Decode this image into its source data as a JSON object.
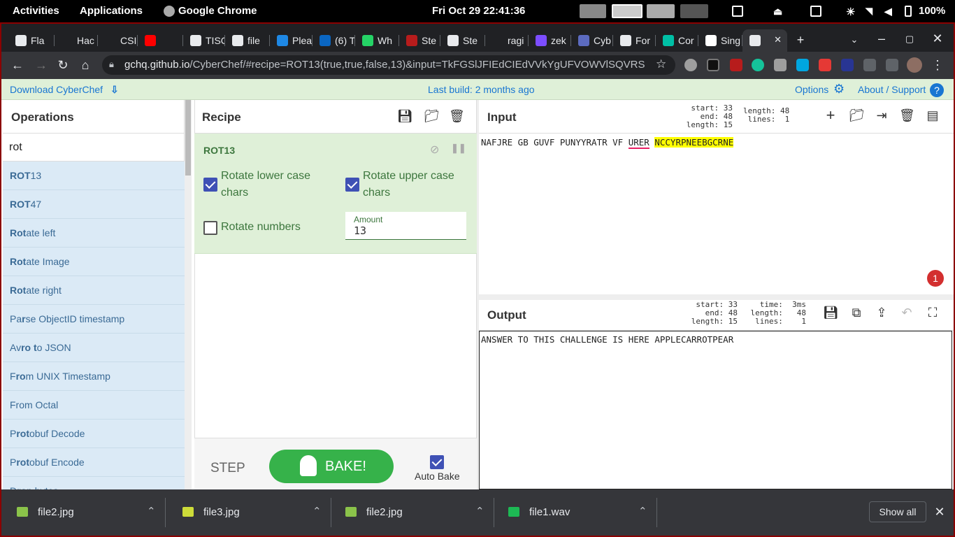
{
  "system": {
    "activities": "Activities",
    "applications": "Applications",
    "app_name": "Google Chrome",
    "clock": "Fri Oct 29  22:41:36",
    "battery": "100%"
  },
  "tabs": [
    {
      "label": "Fla",
      "color": "#e8eaed"
    },
    {
      "label": "Hac",
      "color": "#202124"
    },
    {
      "label": "CSI",
      "color": "#202124"
    },
    {
      "label": "",
      "color": "#ff0000"
    },
    {
      "label": "TISC",
      "color": "#e8eaed"
    },
    {
      "label": "file",
      "color": "#e8eaed"
    },
    {
      "label": "Plea",
      "color": "#1e88e5"
    },
    {
      "label": "(6) T",
      "color": "#0a66c2"
    },
    {
      "label": "Wh",
      "color": "#25d366"
    },
    {
      "label": "Ste",
      "color": "#b71c1c"
    },
    {
      "label": "Ste",
      "color": "#e8eaed"
    },
    {
      "label": "ragi",
      "color": "#202124"
    },
    {
      "label": "zek",
      "color": "#7c4dff"
    },
    {
      "label": "Cyb",
      "color": "#5c6bc0"
    },
    {
      "label": "For",
      "color": "#e8eaed"
    },
    {
      "label": "Cor",
      "color": "#00bfa5"
    },
    {
      "label": "Sing",
      "color": "#ffffff"
    },
    {
      "label": "",
      "color": "#e8eaed"
    }
  ],
  "url": {
    "host": "gchq.github.io",
    "path": "/CyberChef/#recipe=ROT13(true,true,false,13)&input=TkFGSlJFIEdCIEdVVkYgUFVOWVlSQVRSIFZ..."
  },
  "banner": {
    "download": "Download CyberChef",
    "last_build": "Last build: 2 months ago",
    "options": "Options",
    "about": "About / Support"
  },
  "operations": {
    "title": "Operations",
    "search_value": "rot",
    "items": [
      {
        "pre": "",
        "hl": "ROT",
        "post": "13"
      },
      {
        "pre": "",
        "hl": "ROT",
        "post": "47"
      },
      {
        "pre": "",
        "hl": "Rot",
        "post": "ate left"
      },
      {
        "pre": "",
        "hl": "Rot",
        "post": "ate Image"
      },
      {
        "pre": "",
        "hl": "Rot",
        "post": "ate right"
      },
      {
        "pre": "Pa",
        "hl": "r",
        "post": "se ObjectID timestamp"
      },
      {
        "pre": "Av",
        "hl": "ro t",
        "post": "o JSON"
      },
      {
        "pre": "F",
        "hl": "ro",
        "post": "m UNIX Timestamp"
      },
      {
        "pre": "From O",
        "hl": "",
        "post": "ctal"
      },
      {
        "pre": "P",
        "hl": "rot",
        "post": "obuf Decode"
      },
      {
        "pre": "P",
        "hl": "rot",
        "post": "obuf Encode"
      },
      {
        "pre": "D",
        "hl": "ro",
        "post": "p bytes"
      }
    ]
  },
  "recipe": {
    "title": "Recipe",
    "op_name": "ROT13",
    "opt_lower": "Rotate lower case chars",
    "opt_upper": "Rotate upper case chars",
    "opt_numbers": "Rotate numbers",
    "amount_label": "Amount",
    "amount_value": "13",
    "step": "STEP",
    "bake": "BAKE!",
    "autobake": "Auto Bake"
  },
  "input": {
    "title": "Input",
    "stats_left": "start: 33\n  end: 48\nlength: 15",
    "stats_right": "length: 48\n lines:  1",
    "text_plain": "NAFJRE GB GUVF PUNYYRATR VF ",
    "text_underlined": "URER",
    "text_highlighted": "NCCYRPNEEBGCRNE",
    "badge": "1"
  },
  "output": {
    "title": "Output",
    "stats_left": "start: 33\n  end: 48\nlength: 15",
    "stats_right": "  time:  3ms\nlength:   48\n lines:    1",
    "text": "ANSWER TO THIS CHALLENGE IS HERE APPLECARROTPEAR"
  },
  "downloads": [
    {
      "name": "file2.jpg",
      "color": "#8bc34a"
    },
    {
      "name": "file3.jpg",
      "color": "#cddc39"
    },
    {
      "name": "file2.jpg",
      "color": "#8bc34a"
    },
    {
      "name": "file1.wav",
      "color": "#1db954"
    }
  ],
  "shelf": {
    "show_all": "Show all"
  }
}
